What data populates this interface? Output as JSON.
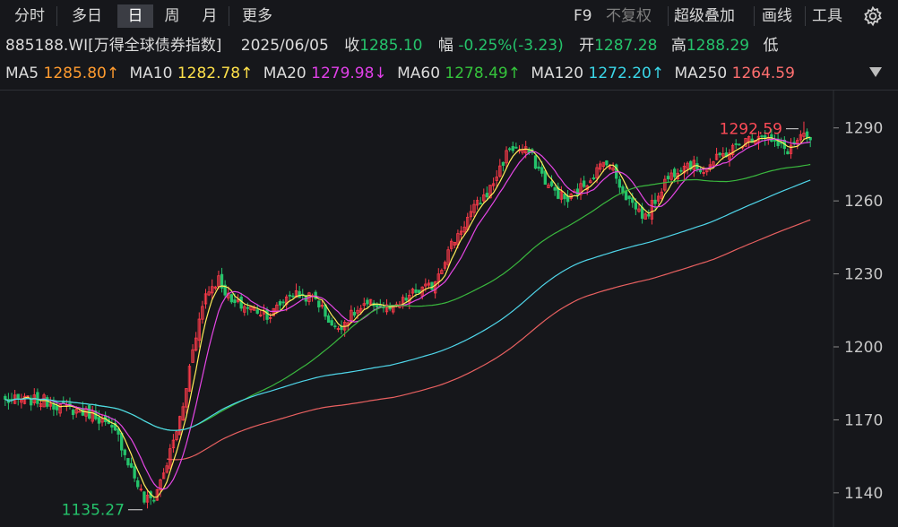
{
  "toolbar": {
    "tabs": [
      {
        "label": "分时",
        "active": false
      },
      {
        "label": "多日",
        "active": false
      },
      {
        "label": "日",
        "active": true
      },
      {
        "label": "周",
        "active": false
      },
      {
        "label": "月",
        "active": false
      },
      {
        "label": "更多",
        "active": false
      }
    ],
    "tools": {
      "f9": "F9",
      "no_adjust": "不复权",
      "overlay": "超级叠加",
      "draw": "画线",
      "tools": "工具"
    }
  },
  "info": {
    "code": "885188.WI",
    "name": "[万得全球债券指数]",
    "date": "2025/06/05",
    "close_label": "收",
    "close": "1285.10",
    "change_label": "幅",
    "change": "-0.25%(-3.23)",
    "open_label": "开",
    "open": "1287.28",
    "high_label": "高",
    "high": "1288.29",
    "low_label": "低",
    "low_ellipsis": "..."
  },
  "ma_bar": [
    {
      "label": "MA5",
      "value": "1285.80↑",
      "color": "#ff9b2f"
    },
    {
      "label": "MA10",
      "value": "1282.78↑",
      "color": "#ffe14a"
    },
    {
      "label": "MA20",
      "value": "1279.98↓",
      "color": "#e040e8"
    },
    {
      "label": "MA60",
      "value": "1278.49↑",
      "color": "#35c43c"
    },
    {
      "label": "MA120",
      "value": "1272.20↑",
      "color": "#3ad6e8"
    },
    {
      "label": "MA250",
      "value": "1264.59",
      "color": "#ff6f6f"
    }
  ],
  "colors": {
    "up": "#ff3b4a",
    "down": "#25c36b",
    "background": "#16171b"
  },
  "chart_data": {
    "type": "candlestick",
    "ylim": [
      1130,
      1298
    ],
    "yticks": [
      "1290",
      "1260",
      "1230",
      "1200",
      "1170",
      "1140"
    ],
    "n_days": 250,
    "max_label": "1292.59",
    "min_label": "1135.27",
    "max_value": 1292.59,
    "min_value": 1135.27,
    "anchors": [
      [
        0,
        1178
      ],
      [
        12,
        1178
      ],
      [
        18,
        1175
      ],
      [
        28,
        1172
      ],
      [
        35,
        1163
      ],
      [
        38,
        1153
      ],
      [
        43,
        1137
      ],
      [
        46,
        1138
      ],
      [
        50,
        1152
      ],
      [
        55,
        1175
      ],
      [
        58,
        1200
      ],
      [
        62,
        1222
      ],
      [
        66,
        1228
      ],
      [
        70,
        1218
      ],
      [
        76,
        1216
      ],
      [
        82,
        1213
      ],
      [
        88,
        1222
      ],
      [
        96,
        1220
      ],
      [
        102,
        1207
      ],
      [
        108,
        1214
      ],
      [
        114,
        1218
      ],
      [
        120,
        1215
      ],
      [
        126,
        1222
      ],
      [
        132,
        1225
      ],
      [
        138,
        1242
      ],
      [
        144,
        1255
      ],
      [
        150,
        1265
      ],
      [
        156,
        1282
      ],
      [
        162,
        1280
      ],
      [
        168,
        1266
      ],
      [
        174,
        1260
      ],
      [
        180,
        1268
      ],
      [
        186,
        1277
      ],
      [
        192,
        1262
      ],
      [
        198,
        1253
      ],
      [
        204,
        1268
      ],
      [
        210,
        1276
      ],
      [
        216,
        1273
      ],
      [
        222,
        1279
      ],
      [
        228,
        1284
      ],
      [
        234,
        1288
      ],
      [
        238,
        1283
      ],
      [
        242,
        1281
      ],
      [
        246,
        1286
      ],
      [
        249,
        1285
      ]
    ],
    "ma_series": [
      {
        "name": "MA5",
        "color": "#ffef5a",
        "period": 5
      },
      {
        "name": "MA10",
        "color": "#e646e6",
        "period": 10
      },
      {
        "name": "MA60",
        "color": "#3ab83e",
        "period": 60
      },
      {
        "name": "MA120",
        "color": "#4fd6ea",
        "period": 120
      },
      {
        "name": "MA250",
        "color": "#e86060",
        "period": 250
      }
    ]
  }
}
